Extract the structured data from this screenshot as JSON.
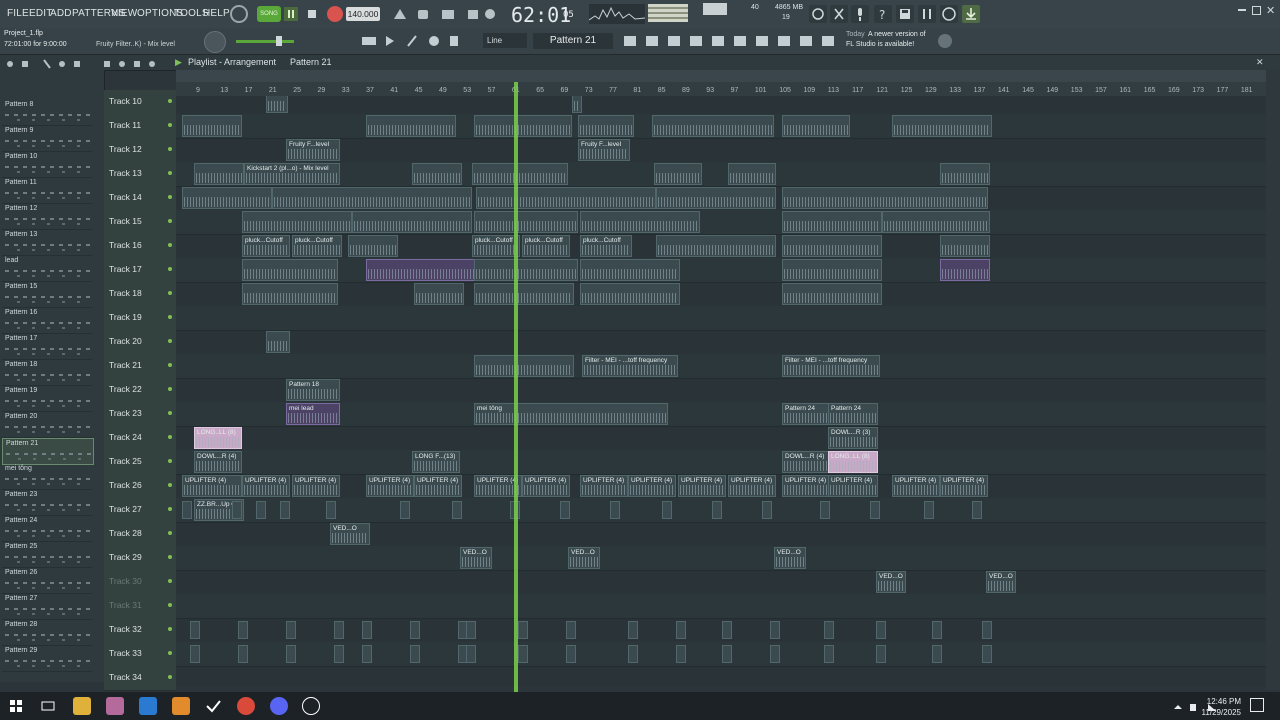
{
  "menu": [
    "FILE",
    "EDIT",
    "ADD",
    "PATTERNS",
    "VIEW",
    "OPTIONS",
    "TOOLS",
    "HELP"
  ],
  "transport": {
    "mode": "SONG",
    "tempo": "140.000",
    "time": "62:01",
    "time_sub": "05",
    "cpu_ram": "4865 MB",
    "cpu_sub": "19",
    "polyphony": "40"
  },
  "project": {
    "name": "Project_1.flp",
    "position": "72:01:00 for 9:00:00",
    "hint": "Fruity Filter..K) - Mix level"
  },
  "snap": "Line",
  "current_pattern": "Pattern 21",
  "news": {
    "line1": "Today",
    "line2": "A newer version of",
    "line3": "FL Studio is available!"
  },
  "playlist": {
    "title": "Playlist - Arrangement",
    "crumb": "Pattern 21"
  },
  "ruler_ticks": [
    "9",
    "13",
    "17",
    "21",
    "25",
    "29",
    "33",
    "37",
    "41",
    "45",
    "49",
    "53",
    "57",
    "61",
    "65",
    "69",
    "73",
    "77",
    "81",
    "85",
    "89",
    "93",
    "97",
    "101",
    "105",
    "109",
    "113",
    "117",
    "121",
    "125",
    "129",
    "133",
    "137",
    "141",
    "145",
    "149",
    "153",
    "157",
    "161",
    "165",
    "169",
    "173",
    "177",
    "181"
  ],
  "patterns": [
    "Pattern 8",
    "Pattern 9",
    "Pattern 10",
    "Pattern 11",
    "Pattern 12",
    "Pattern 13",
    "lead",
    "Pattern 15",
    "Pattern 16",
    "Pattern 17",
    "Pattern 18",
    "Pattern 19",
    "Pattern 20",
    "Pattern 21",
    "mei tông",
    "Pattern 23",
    "Pattern 24",
    "Pattern 25",
    "Pattern 26",
    "Pattern 27",
    "Pattern 28",
    "Pattern 29"
  ],
  "tracks": [
    "Track 10",
    "Track 11",
    "Track 12",
    "Track 13",
    "Track 14",
    "Track 15",
    "Track 16",
    "Track 17",
    "Track 18",
    "Track 19",
    "Track 20",
    "Track 21",
    "Track 22",
    "Track 23",
    "Track 24",
    "Track 25",
    "Track 26",
    "Track 27",
    "Track 28",
    "Track 29",
    "Track 30",
    "Track 31",
    "Track 32",
    "Track 33",
    "Track 34"
  ],
  "clip_labels": {
    "fruity": "Fruity F...level",
    "kick": "Kickstart 2 (pl...o) - Mix level",
    "pluck": "pluck...Cutoff",
    "filter": "Filter - MEI - ...toff frequency",
    "pattern18": "Pattern 18",
    "meilead": "mei lead",
    "meitong": "mei tông",
    "pattern24": "Pattern 24",
    "long": "LONG..LL (8)",
    "longr": "LONG F...(13)",
    "down": "DOWL...R (4)",
    "downr": "DOWL...R (3)",
    "uplifter": "UPLIFTER (4)",
    "zdr": "ZZ.BR...Up G",
    "vedo": "VED...O"
  },
  "taskbar": {
    "time": "12:46 PM",
    "date": "11/29/2025"
  }
}
